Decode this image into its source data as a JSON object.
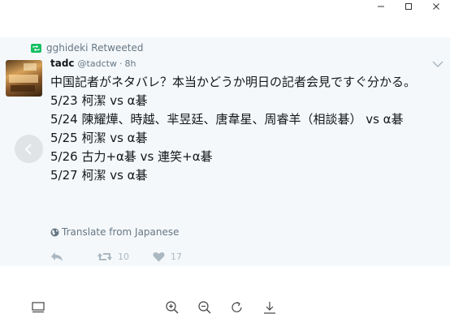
{
  "window": {
    "controls": [
      "minimize",
      "maximize",
      "close"
    ]
  },
  "tweet": {
    "retweeted_by": "gghideki Retweeted",
    "author_name": "tadc",
    "author_handle": "@tadctw",
    "time_separator": "·",
    "time": "8h",
    "text": "中国記者がネタバレ？本当かどうか明日の記者会見ですぐ分かる。\n5/23 柯潔 vs α碁\n5/24 陳耀燁、時越、芈昱廷、唐韋星、周睿羊（相談碁） vs α碁\n5/25 柯潔 vs α碁\n5/26 古力+α碁 vs 連笑+α碁\n5/27 柯潔 vs α碁",
    "translate_label": "Translate from Japanese",
    "retweet_count": "10",
    "like_count": "17"
  },
  "colors": {
    "card_bg": "#f5f8fa",
    "retweet_green": "#17bf63",
    "muted": "#657786",
    "action_gray": "#aab8c2"
  },
  "icons": {
    "window": [
      "minimize-icon",
      "maximize-icon",
      "close-icon"
    ],
    "toolbar": [
      "layout-icon",
      "zoom-in-icon",
      "zoom-out-icon",
      "rotate-icon",
      "download-icon"
    ]
  }
}
